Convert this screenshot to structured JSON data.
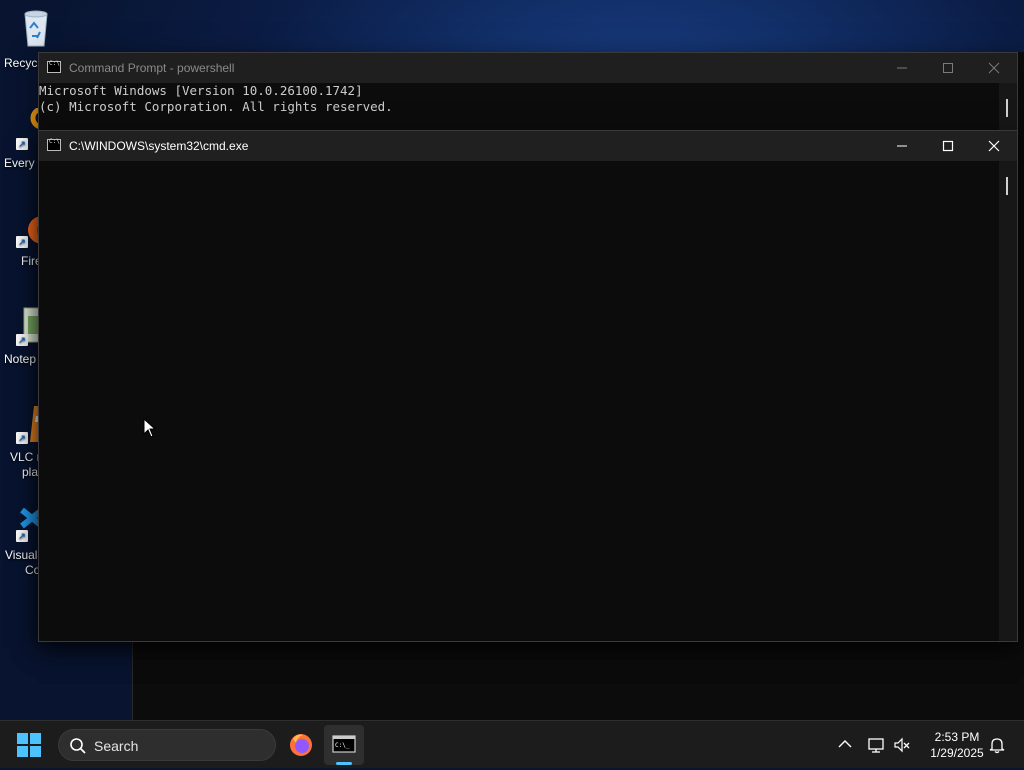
{
  "desktop": {
    "icons": [
      {
        "label": "Recyc",
        "icon": "recycle-bin-icon"
      },
      {
        "label": "Every",
        "icon": "everything-search-icon"
      },
      {
        "label": "Fire",
        "icon": "firefox-icon"
      },
      {
        "label": "Notep",
        "icon": "notepad-icon"
      },
      {
        "label": "VLC m",
        "label2": "pla",
        "icon": "vlc-icon"
      },
      {
        "label": "Visual",
        "label2": "Co",
        "icon": "vscode-icon"
      }
    ]
  },
  "windows": {
    "powershell": {
      "title": "Command Prompt - powershell",
      "lines": [
        "Microsoft Windows [Version 10.0.26100.1742]",
        "(c) Microsoft Corporation. All rights reserved."
      ]
    },
    "cmd": {
      "title": "C:\\WINDOWS\\system32\\cmd.exe",
      "lines": []
    }
  },
  "taskbar": {
    "search_placeholder": "Search",
    "apps": [
      "firefox-icon",
      "terminal-icon"
    ],
    "clock_time": "2:53 PM",
    "clock_date": "1/29/2025"
  },
  "colors": {
    "accent": "#4cc2ff",
    "console_bg": "#0c0c0c",
    "console_text": "#cccccc",
    "titlebar": "#202020"
  }
}
